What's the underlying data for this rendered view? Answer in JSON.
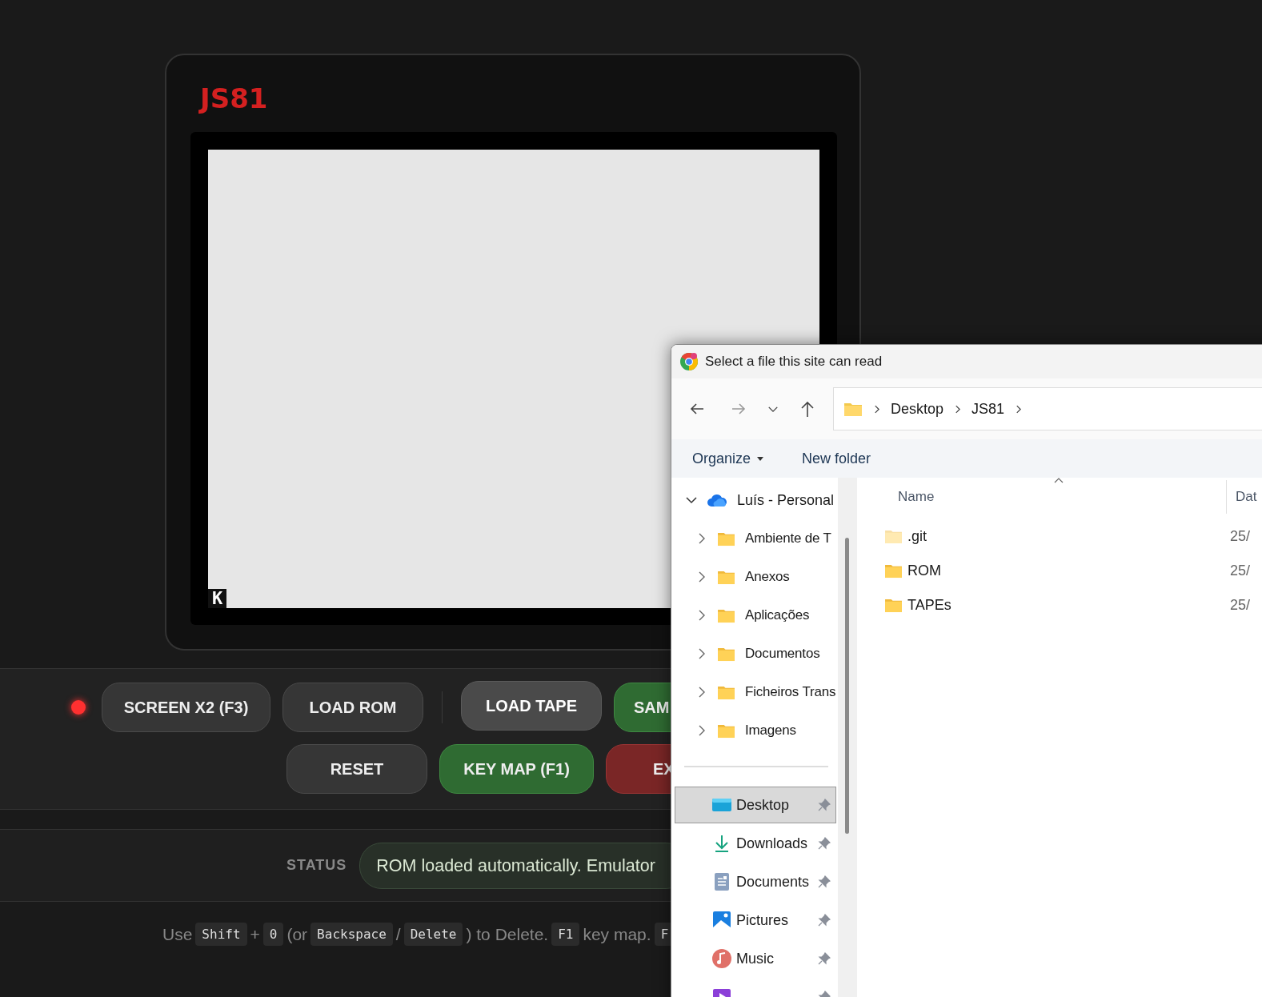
{
  "app": {
    "title": "JS81",
    "cursor": "K"
  },
  "controls": {
    "power_led": {
      "on": true
    },
    "buttons": [
      {
        "label": "SCREEN X2 (F3)",
        "kind": "gray"
      },
      {
        "label": "LOAD ROM",
        "kind": "gray"
      },
      {
        "label": "LOAD TAPE",
        "kind": "light"
      },
      {
        "label": "SAM",
        "kind": "green"
      },
      {
        "label": "RESET",
        "kind": "gray"
      },
      {
        "label": "KEY MAP (F1)",
        "kind": "green"
      },
      {
        "label": "EX",
        "kind": "red"
      }
    ]
  },
  "status": {
    "label": "STATUS",
    "message": "ROM loaded automatically. Emulator"
  },
  "help": [
    {
      "kind": "text",
      "text": "Use"
    },
    {
      "kind": "key",
      "text": "Shift"
    },
    {
      "kind": "text",
      "text": "+"
    },
    {
      "kind": "key",
      "text": "0"
    },
    {
      "kind": "text",
      "text": "(or"
    },
    {
      "kind": "key",
      "text": "Backspace"
    },
    {
      "kind": "text",
      "text": "/"
    },
    {
      "kind": "key",
      "text": "Delete"
    },
    {
      "kind": "text",
      "text": ") to Delete."
    },
    {
      "kind": "key",
      "text": "F1"
    },
    {
      "kind": "text",
      "text": "key map."
    },
    {
      "kind": "key",
      "text": "F"
    }
  ],
  "dialog": {
    "title": "Select a file this site can read",
    "path": [
      "Desktop",
      "JS81"
    ],
    "commands": [
      {
        "label": "Organize",
        "kind": "menu"
      },
      {
        "label": "New folder",
        "kind": "plain"
      }
    ],
    "tree": {
      "label": "Luís - Personal",
      "expanded": true,
      "children": [
        {
          "label": "Ambiente de T",
          "expanded": false
        },
        {
          "label": "Anexos",
          "expanded": false
        },
        {
          "label": "Aplicações",
          "expanded": false
        },
        {
          "label": "Documentos",
          "expanded": false
        },
        {
          "label": "Ficheiros Trans",
          "expanded": false
        },
        {
          "label": "Imagens",
          "expanded": false
        }
      ]
    },
    "quick_access": [
      {
        "label": "Desktop",
        "kind": "desktop",
        "selected": true
      },
      {
        "label": "Downloads",
        "kind": "downloads",
        "selected": false
      },
      {
        "label": "Documents",
        "kind": "documents",
        "selected": false
      },
      {
        "label": "Pictures",
        "kind": "pictures",
        "selected": false
      },
      {
        "label": "Music",
        "kind": "music",
        "selected": false
      },
      {
        "kind": "videos",
        "selected": false
      }
    ],
    "columns": [
      "Name",
      "Dat"
    ],
    "files": [
      {
        "name": ".git",
        "hidden": true,
        "column_2": "25/"
      },
      {
        "name": "ROM",
        "hidden": false,
        "column_2": "25/"
      },
      {
        "name": "TAPEs",
        "hidden": false,
        "column_2": "25/"
      }
    ]
  }
}
